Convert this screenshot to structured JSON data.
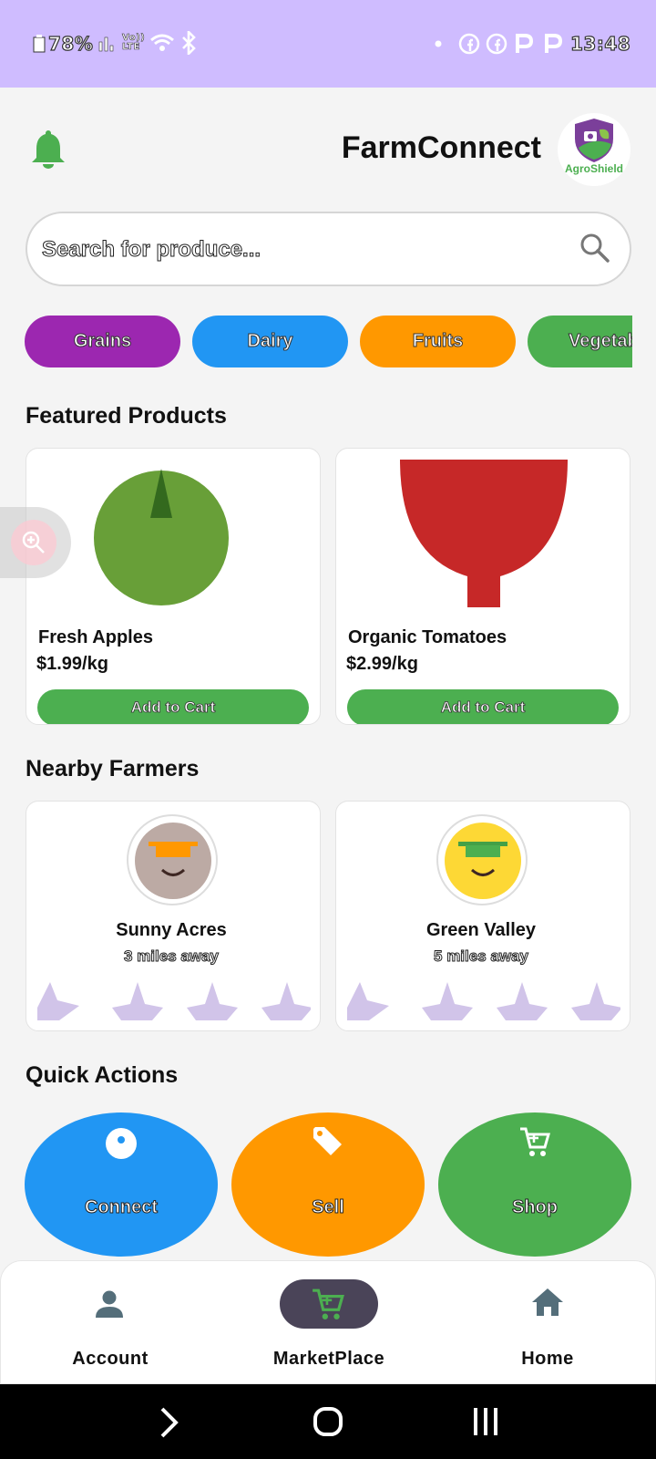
{
  "status": {
    "battery": "78%",
    "net": "Vo)) LTE",
    "time": "13:48",
    "icon_names": [
      "battery-icon",
      "signal-icon",
      "wifi-icon",
      "bluetooth-icon",
      "dot-icon",
      "facebook-icon",
      "facebook-icon",
      "p-icon",
      "p-icon"
    ]
  },
  "header": {
    "title": "FarmConnect",
    "logo_text": "AgroShield"
  },
  "search": {
    "placeholder": "Search for produce..."
  },
  "categories": [
    {
      "label": "Grains",
      "color": "#9c27b0"
    },
    {
      "label": "Dairy",
      "color": "#2196f3"
    },
    {
      "label": "Fruits",
      "color": "#ff9800"
    },
    {
      "label": "Vegetab",
      "color": "#4caf50"
    }
  ],
  "featured": {
    "title": "Featured Products",
    "products": [
      {
        "name": "Fresh Apples",
        "price": "$1.99/kg",
        "button": "Add to Cart",
        "color": "#689f38"
      },
      {
        "name": "Organic Tomatoes",
        "price": "$2.99/kg",
        "button": "Add to Cart",
        "color": "#c62828"
      }
    ]
  },
  "farmers": {
    "title": "Nearby Farmers",
    "items": [
      {
        "name": "Sunny Acres",
        "distance": "3 miles away",
        "face_color": "#bcaaa4",
        "hat_color": "#ff9800",
        "rating": 0.5
      },
      {
        "name": "Green Valley",
        "distance": "5 miles away",
        "face_color": "#fdd835",
        "hat_color": "#4caf50",
        "rating": 0.25
      }
    ]
  },
  "quick_actions": {
    "title": "Quick Actions",
    "items": [
      {
        "label": "Connect",
        "color": "#2196f3",
        "icon": "connect-icon"
      },
      {
        "label": "Sell",
        "color": "#ff9800",
        "icon": "tag-icon"
      },
      {
        "label": "Shop",
        "color": "#4caf50",
        "icon": "cart-icon"
      }
    ]
  },
  "nav": {
    "items": [
      {
        "label": "Account",
        "icon": "person-icon"
      },
      {
        "label": "MarketPlace",
        "icon": "cart-icon",
        "active": true
      },
      {
        "label": "Home",
        "icon": "home-icon"
      }
    ]
  },
  "colors": {
    "status_bar": "#cfbcff",
    "accent_green": "#4caf50",
    "nav_pill": "#4a4458",
    "star": "#d1c4e9"
  }
}
